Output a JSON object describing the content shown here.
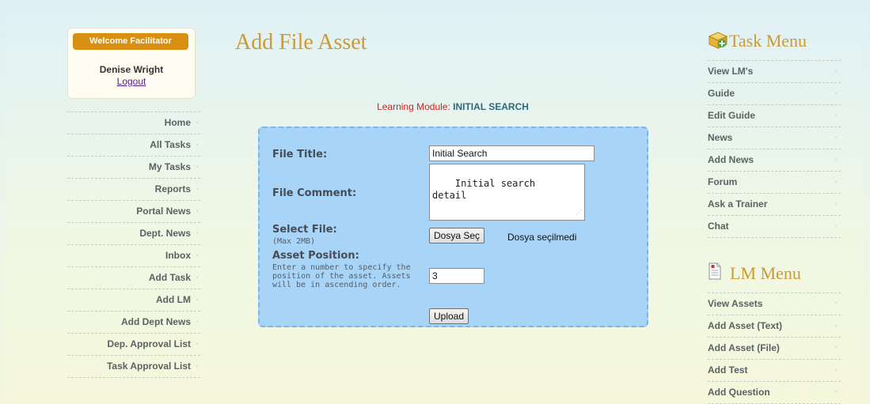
{
  "user_box": {
    "badge": "Welcome Facilitator",
    "name": "Denise Wright",
    "logout": "Logout"
  },
  "left_nav": [
    "Home",
    "All Tasks",
    "My Tasks",
    "Reports",
    "Portal News",
    "Dept. News",
    "Inbox",
    "Add Task",
    "Add LM",
    "Add Dept News",
    "Dep. Approval List",
    "Task Approval List"
  ],
  "page_title": "Add File Asset",
  "learning_module": {
    "label": "Learning Module:",
    "value": "INITIAL SEARCH"
  },
  "form": {
    "file_title_label": "File Title:",
    "file_title_value": "Initial Search",
    "file_comment_label": "File Comment:",
    "file_comment_value": "Initial search\ndetail",
    "select_file_label": "Select File:",
    "select_file_hint": "(Max 2MB)",
    "choose_button": "Dosya Seç",
    "no_file_text": "Dosya seçilmedi",
    "asset_position_label": "Asset Position:",
    "asset_position_hint": "Enter a number to specify the position of the asset. Assets will be in ascending order.",
    "asset_position_value": "3",
    "upload_button": "Upload"
  },
  "task_menu": {
    "title": "Task Menu",
    "icon": "box-add-icon",
    "items": [
      "View LM's",
      "Guide",
      "Edit Guide",
      "News",
      "Add News",
      "Forum",
      "Ask a Trainer",
      "Chat"
    ]
  },
  "lm_menu": {
    "title": "LM Menu",
    "icon": "document-icon",
    "items": [
      "View Assets",
      "Add Asset (Text)",
      "Add Asset (File)",
      "Add Test",
      "Add Question"
    ]
  },
  "colors": {
    "accent": "#cc9933",
    "badge": "#d98f12",
    "form_bg": "#a8d4f7",
    "lm_label": "#d42020"
  }
}
